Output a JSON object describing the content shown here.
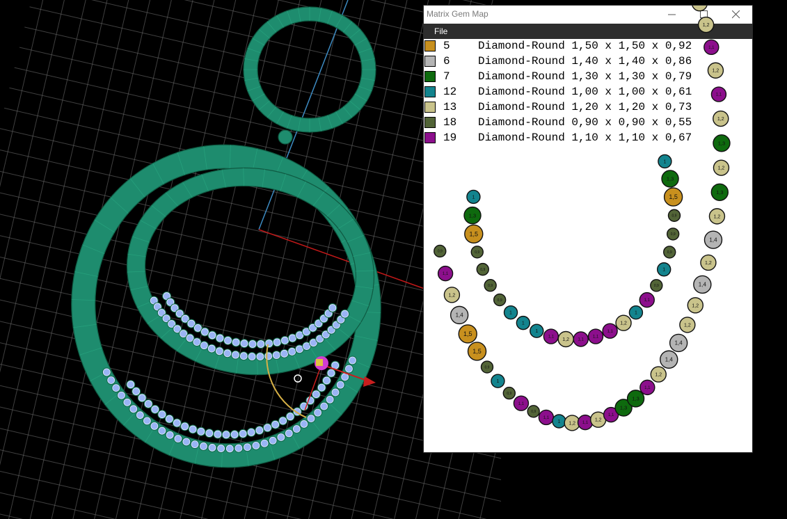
{
  "window": {
    "title": "Matrix Gem Map",
    "menu": [
      "File"
    ]
  },
  "colors": {
    "bronze": "#c8901e",
    "silver": "#b4b4b4",
    "dark_green": "#0e6a0e",
    "teal": "#13848e",
    "khaki": "#c9c38b",
    "olive": "#526437",
    "purple": "#8c0f8c",
    "model_green": "#1e8c6e",
    "stone_blue": "#9ab4f5"
  },
  "legend": [
    {
      "id": "5",
      "desc": "Diamond-Round 1,50 x 1,50 x 0,92",
      "color": "#c8901e"
    },
    {
      "id": "6",
      "desc": "Diamond-Round 1,40 x 1,40 x 0,86",
      "color": "#b4b4b4"
    },
    {
      "id": "7",
      "desc": "Diamond-Round 1,30 x 1,30 x 0,79",
      "color": "#0e6a0e"
    },
    {
      "id": "12",
      "desc": "Diamond-Round 1,00 x 1,00 x 0,61",
      "color": "#13848e"
    },
    {
      "id": "13",
      "desc": "Diamond-Round 1,20 x 1,20 x 0,73",
      "color": "#c9c38b"
    },
    {
      "id": "18",
      "desc": "Diamond-Round 0,90 x 0,90 x 0,55",
      "color": "#526437"
    },
    {
      "id": "19",
      "desc": "Diamond-Round 1,10 x 1,10 x 0,67",
      "color": "#8c0f8c"
    }
  ],
  "gem_map": {
    "labels": {
      "5": "1,5",
      "6": "1,4",
      "7": "1,3",
      "12": "1",
      "13": "1,2",
      "18": "0,9",
      "19": "1,1"
    },
    "inner_arc": [
      "12",
      "7",
      "5",
      "18",
      "18",
      "18",
      "18",
      "12",
      "12",
      "12",
      "19",
      "13",
      "19",
      "19",
      "19",
      "13",
      "12",
      "19",
      "18",
      "12",
      "18",
      "18",
      "18",
      "5",
      "7",
      "12"
    ],
    "outer_arc": [
      "18",
      "19",
      "13",
      "6",
      "5",
      "5",
      "18",
      "12",
      "18",
      "19",
      "18",
      "19",
      "12",
      "13",
      "19",
      "13",
      "19",
      "7",
      "7",
      "19",
      "13",
      "6",
      "6",
      "13",
      "13",
      "6",
      "13",
      "6",
      "13",
      "7",
      "13",
      "7",
      "13",
      "19",
      "13",
      "19",
      "13",
      "13",
      "12",
      "19",
      "12",
      "18",
      "18",
      "12",
      "5",
      "19",
      "18"
    ]
  }
}
